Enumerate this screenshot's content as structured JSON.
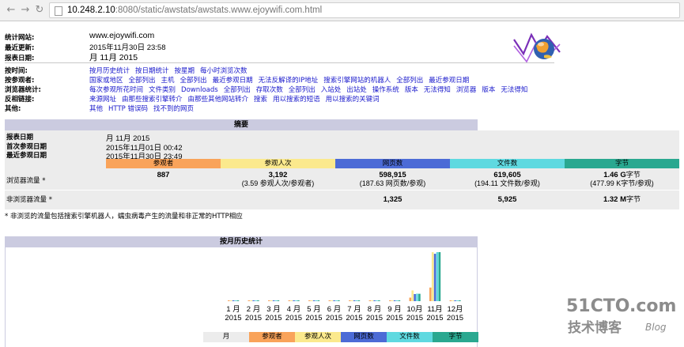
{
  "browser": {
    "url_host": "10.248.2.10",
    "url_rest": ":8080/static/awstats/awstats.www.ejoywifi.com.html"
  },
  "info": {
    "site_label": "统计网站:",
    "site_value": "www.ejoywifi.com",
    "updated_label": "最近更新:",
    "updated_value": "2015年11月30日 23:58",
    "report_label": "报表日期:",
    "report_value": "月 11月 2015"
  },
  "nav": [
    {
      "label": "按时间:",
      "links": [
        "按月历史统计",
        "按日期统计",
        "按星期",
        "每小时浏览次数"
      ]
    },
    {
      "label": "按参观者:",
      "links": [
        "国家或地区",
        "全部列出",
        "主机",
        "全部列出",
        "最近参观日期",
        "无法反解译的IP地址",
        "搜索引擎网站的机器人",
        "全部列出",
        "最近参观日期"
      ]
    },
    {
      "label": "浏览器统计:",
      "links": [
        "每次参观所花时间",
        "文件类别",
        "Downloads",
        "全部列出",
        "存取次数",
        "全部列出",
        "入站处",
        "出站处",
        "操作系统",
        "版本",
        "无法得知",
        "浏览器",
        "版本",
        "无法得知"
      ]
    },
    {
      "label": "反相链接:",
      "links": [
        "来源网址",
        "由那些搜索引擎转介",
        "由那些其他网站转介",
        "搜索",
        "用以搜索的短语",
        "用以搜索的关键词"
      ]
    },
    {
      "label": "其他:",
      "links": [
        "其他",
        "HTTP 错误码",
        "找不到的网页"
      ]
    }
  ],
  "summary": {
    "title": "摘要",
    "period_label": "报表日期",
    "period_value": "月 11月 2015",
    "first_label": "首次参观日期",
    "first_value": "2015年11月01日 00:42",
    "last_label": "最近参观日期",
    "last_value": "2015年11月30日 23:49",
    "columns": [
      "参观者",
      "参观人次",
      "网页数",
      "文件数",
      "字节"
    ],
    "viewed_label": "浏览器流量 *",
    "viewed": {
      "visitors": "887",
      "visits": "3,192",
      "visits_sub": "(3.59 参观人次/参观者)",
      "pages": "598,915",
      "pages_sub": "(187.63 网页数/参观)",
      "hits": "619,605",
      "hits_sub": "(194.11 文件数/参观)",
      "bandwidth": "1.46 G",
      "bandwidth_unit": "字节",
      "bandwidth_sub": "(477.99 K字节/参观)"
    },
    "notviewed_label": "非浏览器流量 *",
    "notviewed": {
      "pages": "1,325",
      "hits": "5,925",
      "bandwidth": "1.32 M",
      "bandwidth_unit": "字节"
    },
    "footnote": "* 非浏览的流量包括搜索引擎机器人，蠕虫病毒产生的流量和非正常的HTTP相应"
  },
  "history": {
    "title": "按月历史统计",
    "months": [
      "1 月\n2015",
      "2 月\n2015",
      "3 月\n2015",
      "4 月\n2015",
      "5 月\n2015",
      "6 月\n2015",
      "7 月\n2015",
      "8 月\n2015",
      "9 月\n2015",
      "10月\n2015",
      "11月\n2015",
      "12月\n2015"
    ],
    "month_labels": [
      "1 月",
      "2 月",
      "3 月",
      "4 月",
      "5 月",
      "6 月",
      "7 月",
      "8 月",
      "9 月",
      "10月",
      "11月",
      "12月"
    ],
    "year_label": "2015",
    "table_headers": [
      "月",
      "参观者",
      "参观人次",
      "网页数",
      "文件数",
      "字节"
    ]
  },
  "chart_data": {
    "type": "bar",
    "categories": [
      "1 月 2015",
      "2 月 2015",
      "3 月 2015",
      "4 月 2015",
      "5 月 2015",
      "6 月 2015",
      "7 月 2015",
      "8 月 2015",
      "9 月 2015",
      "10月 2015",
      "11月 2015",
      "12月 2015"
    ],
    "series": [
      {
        "name": "参观者",
        "values": [
          0,
          0,
          0,
          0,
          0,
          0,
          0,
          0,
          0,
          230,
          887,
          0
        ]
      },
      {
        "name": "参观人次",
        "values": [
          0,
          0,
          0,
          0,
          0,
          0,
          0,
          0,
          0,
          700,
          3192,
          0
        ]
      },
      {
        "name": "网页数",
        "values": [
          0,
          0,
          0,
          0,
          0,
          0,
          0,
          0,
          0,
          90000,
          598915,
          0
        ]
      },
      {
        "name": "文件数",
        "values": [
          0,
          0,
          0,
          0,
          0,
          0,
          0,
          0,
          0,
          95000,
          619605,
          0
        ]
      },
      {
        "name": "字节",
        "values": [
          0,
          0,
          0,
          0,
          0,
          0,
          0,
          0,
          0,
          0.22,
          1.46,
          0
        ]
      }
    ]
  },
  "colors": {
    "visitors": "#f9a35a",
    "visits": "#fbe98d",
    "pages": "#4c6bd6",
    "hits": "#5fd9e0",
    "bandwidth": "#2aa890",
    "header_bg": "#cbcbe0"
  },
  "watermark": {
    "line1": "51CTO.com",
    "line2": "技术博客",
    "line3": "Blog"
  }
}
